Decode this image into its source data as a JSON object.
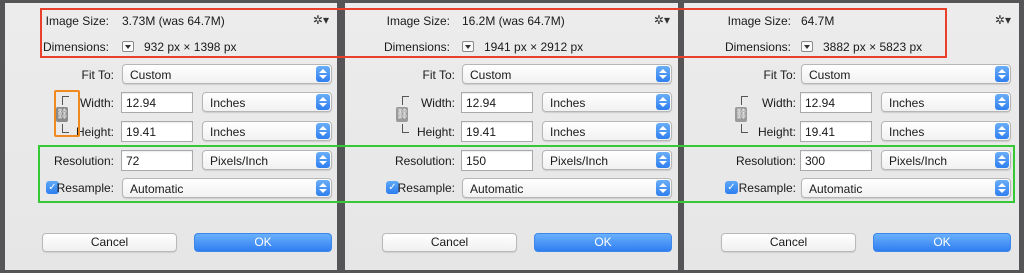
{
  "labels": {
    "image_size": "Image Size:",
    "dimensions": "Dimensions:",
    "fit_to": "Fit To:",
    "width": "Width:",
    "height": "Height:",
    "resolution": "Resolution:",
    "resample": "Resample:",
    "px": "px",
    "times": "×"
  },
  "icons": {
    "gear": "gear-icon",
    "link": "chain-link-icon",
    "checkbox": "checkmark-icon",
    "dimension_unit_menu": "triangle-down-icon"
  },
  "colors": {
    "highlight_red": "#e8402b",
    "highlight_green": "#35c935",
    "highlight_orange": "#f08a1e",
    "accent_blue": "#2f7ef2"
  },
  "panels": [
    {
      "image_size": "3.73M (was 64.7M)",
      "dim_w": "932",
      "dim_h": "1398",
      "fit_to": "Custom",
      "width": "12.94",
      "width_unit": "Inches",
      "height": "19.41",
      "height_unit": "Inches",
      "resolution": "72",
      "resolution_unit": "Pixels/Inch",
      "resample_checked": true,
      "resample": "Automatic",
      "cancel": "Cancel",
      "ok": "OK"
    },
    {
      "image_size": "16.2M (was 64.7M)",
      "dim_w": "1941",
      "dim_h": "2912",
      "fit_to": "Custom",
      "width": "12.94",
      "width_unit": "Inches",
      "height": "19.41",
      "height_unit": "Inches",
      "resolution": "150",
      "resolution_unit": "Pixels/Inch",
      "resample_checked": true,
      "resample": "Automatic",
      "cancel": "Cancel",
      "ok": "OK"
    },
    {
      "image_size": "64.7M",
      "dim_w": "3882",
      "dim_h": "5823",
      "fit_to": "Custom",
      "width": "12.94",
      "width_unit": "Inches",
      "height": "19.41",
      "height_unit": "Inches",
      "resolution": "300",
      "resolution_unit": "Pixels/Inch",
      "resample_checked": true,
      "resample": "Automatic",
      "cancel": "Cancel",
      "ok": "OK"
    }
  ]
}
